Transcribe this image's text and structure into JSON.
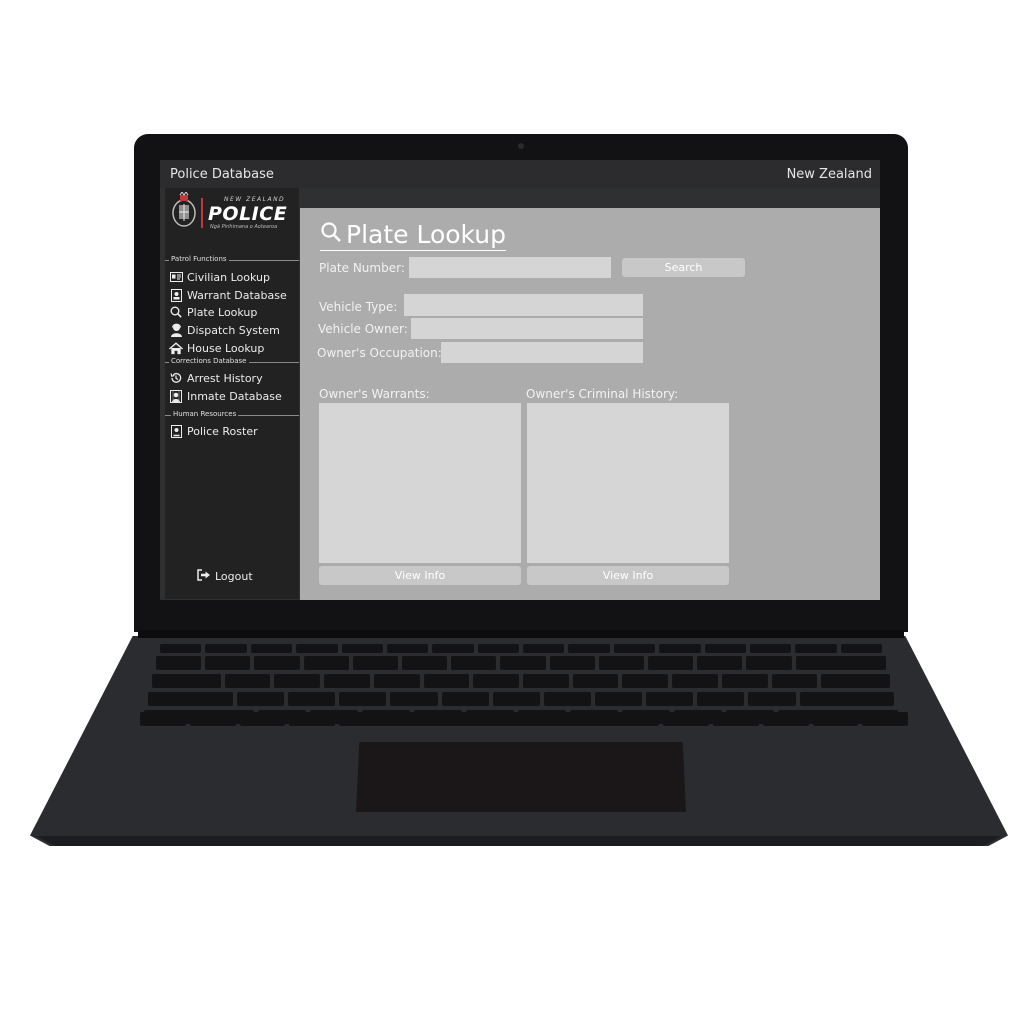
{
  "window": {
    "title": "Police Database",
    "region": "New Zealand"
  },
  "logo": {
    "top_line": "NEW ZEALAND",
    "name": "POLICE",
    "motto": "Ngā Pirihimana o Aotearoa"
  },
  "sidebar": {
    "sections": [
      {
        "label": "Patrol Functions"
      },
      {
        "label": "Corrections Database"
      },
      {
        "label": "Human Resources"
      }
    ],
    "items": [
      {
        "label": "Civilian Lookup",
        "icon": "id-card-icon"
      },
      {
        "label": "Warrant Database",
        "icon": "warrant-doc-icon"
      },
      {
        "label": "Plate Lookup",
        "icon": "search-icon"
      },
      {
        "label": "Dispatch System",
        "icon": "dispatcher-icon"
      },
      {
        "label": "House Lookup",
        "icon": "house-icon"
      },
      {
        "label": "Arrest History",
        "icon": "history-icon"
      },
      {
        "label": "Inmate Database",
        "icon": "inmate-icon"
      },
      {
        "label": "Police Roster",
        "icon": "roster-icon"
      }
    ],
    "logout_label": "Logout"
  },
  "main": {
    "page_title": "Plate Lookup",
    "plate_label": "Plate Number:",
    "plate_value": "",
    "search_label": "Search",
    "vehicle_type_label": "Vehicle Type:",
    "vehicle_owner_label": "Vehicle Owner:",
    "occupation_label": "Owner's Occupation:",
    "warrants_label": "Owner's Warrants:",
    "history_label": "Owner's Criminal History:",
    "view_info_label": "View Info"
  },
  "colors": {
    "accent_red": "#c0393b",
    "content_bg": "#acacac",
    "sidebar_bg": "#222223"
  }
}
